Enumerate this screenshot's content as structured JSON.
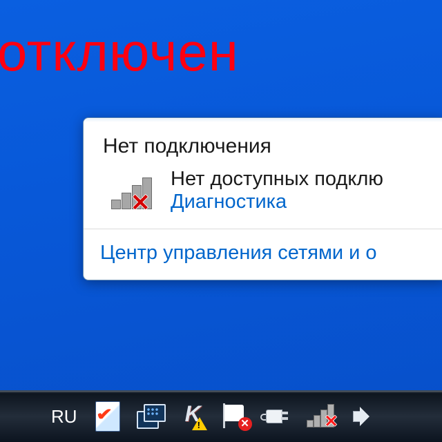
{
  "overlay": {
    "label": "отключен",
    "color": "#ff0010"
  },
  "popup": {
    "header": "Нет подключения",
    "status_line": "Нет доступных подклю",
    "diagnose_link": "Диагностика",
    "footer_link": "Центр управления сетями и о"
  },
  "taskbar": {
    "language": "RU",
    "icons": {
      "defender": "security-report-icon",
      "window_switcher": "window-switcher-icon",
      "antivirus": "antivirus-warning-icon",
      "action_center": "action-center-error-icon",
      "power": "power-plug-icon",
      "network": "network-disconnected-icon",
      "volume": "volume-icon"
    }
  }
}
